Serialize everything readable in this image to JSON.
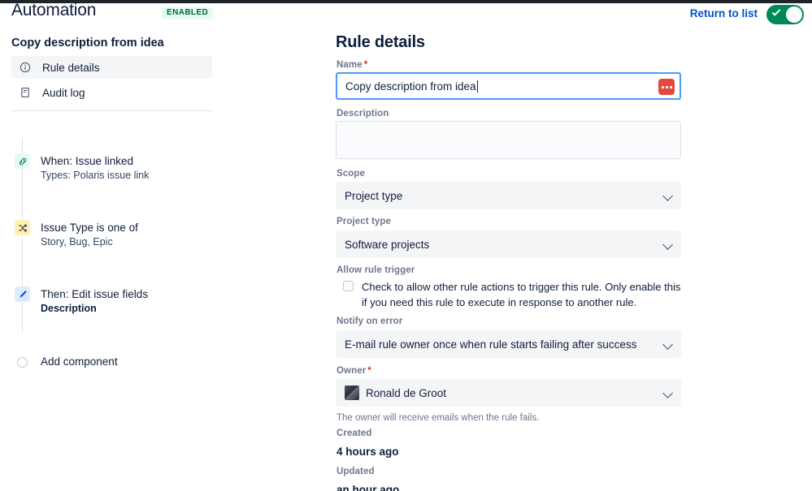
{
  "header": {
    "app_title": "Automation",
    "status_badge": "ENABLED",
    "return_link": "Return to list",
    "toggle_on": true,
    "accent_blue": "#0052cc",
    "enabled_green": "#00875a",
    "badge_bg": "#e3fcef",
    "badge_fg": "#006644"
  },
  "sidebar": {
    "rule_name": "Copy description from idea",
    "nav": [
      {
        "label": "Rule details",
        "icon": "info-circle-icon",
        "selected": true
      },
      {
        "label": "Audit log",
        "icon": "document-list-icon",
        "selected": false
      }
    ],
    "components": [
      {
        "title": "When: Issue linked",
        "subtitle": "Types: Polaris issue link",
        "icon": "link-icon",
        "icon_bg": "#e3fcef",
        "kind": "trigger"
      },
      {
        "title": "Issue Type is one of",
        "subtitle": "Story, Bug, Epic",
        "icon": "branch-shuffle-icon",
        "icon_bg": "#fff0b3",
        "kind": "condition"
      },
      {
        "title": "Then: Edit issue fields",
        "subtitle": "Description",
        "icon": "pencil-icon",
        "icon_bg": "#deebff",
        "kind": "action"
      },
      {
        "title": "Add component",
        "subtitle": "",
        "icon": "circle-outline-icon",
        "icon_bg": "transparent",
        "kind": "add"
      }
    ]
  },
  "main": {
    "panel_title": "Rule details",
    "name": {
      "label": "Name",
      "required": "*",
      "value": "Copy description from idea",
      "placeholder": "",
      "extension_icon": "password-manager-icon"
    },
    "description": {
      "label": "Description",
      "value": "",
      "placeholder": ""
    },
    "scope": {
      "label": "Scope",
      "value": "Project type"
    },
    "project_type": {
      "label": "Project type",
      "value": "Software projects"
    },
    "allow_rule_trigger": {
      "label": "Allow rule trigger",
      "checkbox_label": "Check to allow other rule actions to trigger this rule. Only enable this if you need this rule to execute in response to another rule.",
      "checked": false
    },
    "notify_on_error": {
      "label": "Notify on error",
      "value": "E-mail rule owner once when rule starts failing after success"
    },
    "owner": {
      "label": "Owner",
      "required": "*",
      "value": "Ronald de Groot",
      "helper": "The owner will receive emails when the rule fails."
    },
    "created": {
      "label": "Created",
      "value": "4 hours ago"
    },
    "updated": {
      "label": "Updated",
      "value": "an hour ago"
    }
  }
}
